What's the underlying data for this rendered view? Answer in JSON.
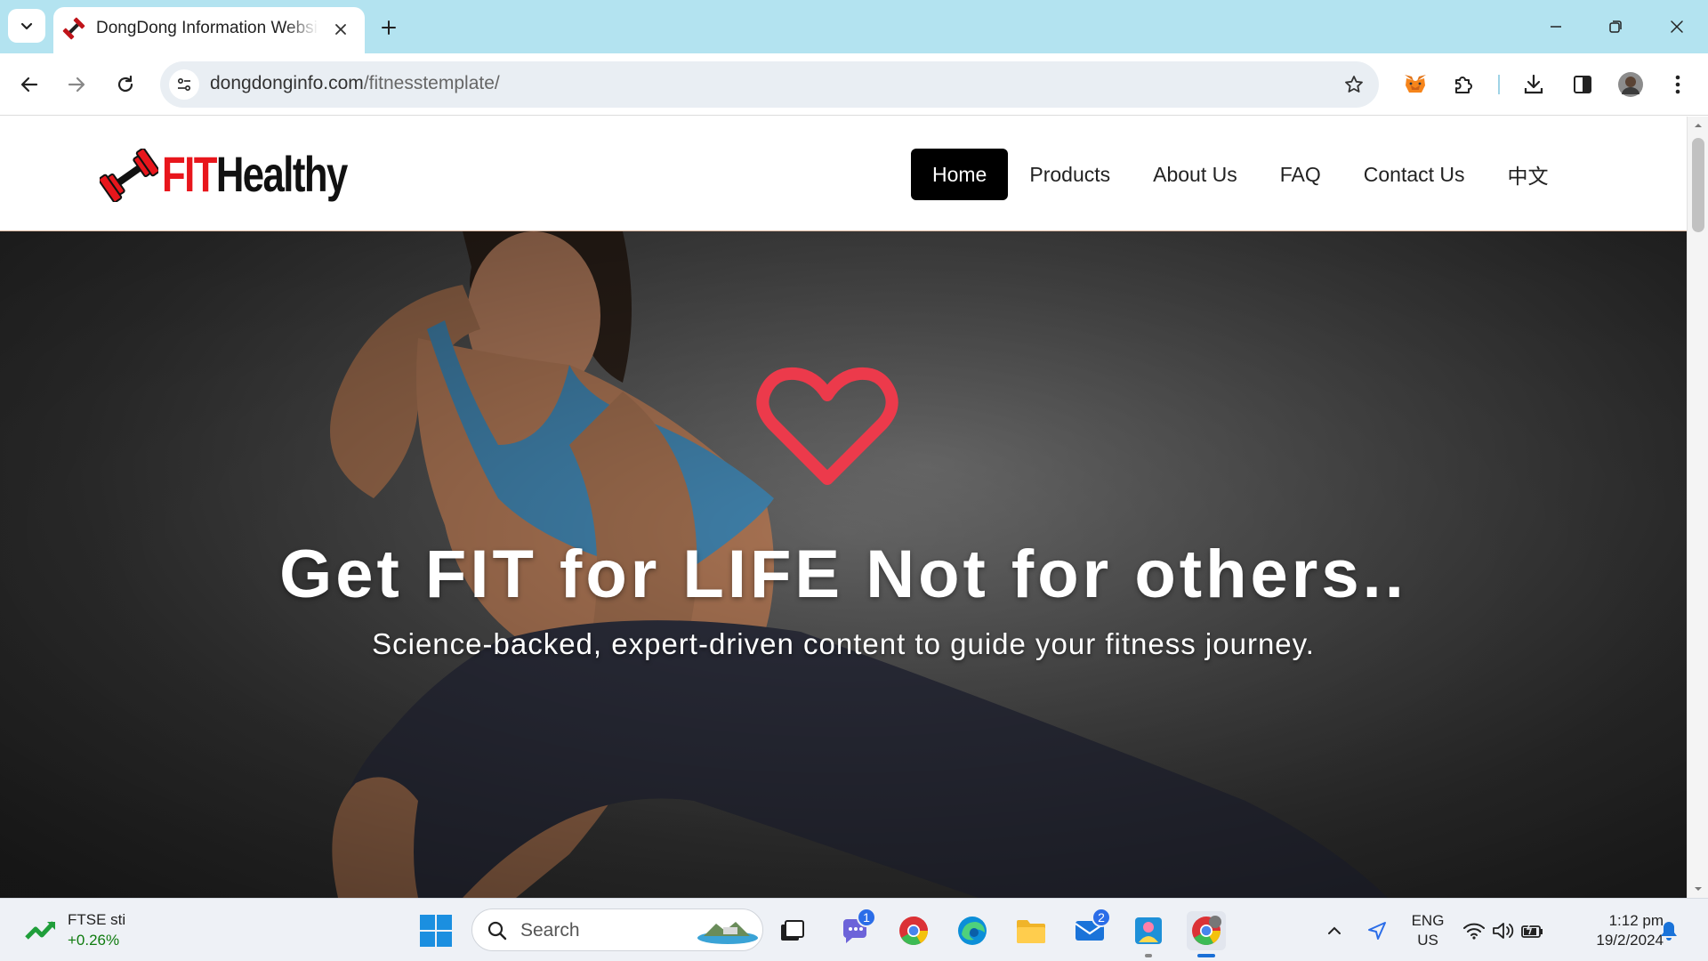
{
  "browser": {
    "tab_title": "DongDong Information Website",
    "url_domain": "dongdonginfo.com",
    "url_path": "/fitnesstemplate/",
    "icons": [
      "tab-list-icon",
      "close-icon",
      "plus-icon",
      "minimize-icon",
      "restore-icon",
      "back-icon",
      "forward-icon",
      "reload-icon",
      "site-info-icon",
      "star-icon",
      "metamask-icon",
      "extensions-icon",
      "download-icon",
      "side-panel-icon",
      "profile-avatar",
      "more-icon"
    ]
  },
  "site": {
    "logo": {
      "fit": "FIT",
      "healthy": "Healthy"
    },
    "nav": [
      "Home",
      "Products",
      "About Us",
      "FAQ",
      "Contact Us",
      "中文"
    ],
    "active_nav": "Home",
    "hero": {
      "title": "Get FIT for LIFE Not for others..",
      "subtitle": "Science-backed, expert-driven content to guide your fitness journey.",
      "heart_color": "#ec3a4b"
    },
    "accent_color": "#e8161c"
  },
  "taskbar": {
    "widget": {
      "name": "FTSE sti",
      "change": "+0.26%"
    },
    "search_placeholder": "Search",
    "badges": {
      "teams": "1",
      "mail": "2"
    },
    "language": {
      "line1": "ENG",
      "line2": "US"
    },
    "clock": {
      "time": "1:12 pm",
      "date": "19/2/2024"
    }
  }
}
